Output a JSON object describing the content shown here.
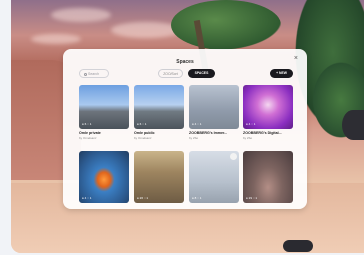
{
  "panel": {
    "title": "Spaces",
    "close_label": "×",
    "search_placeholder": "Search",
    "sort_label": "ZOO/Sort",
    "spaces_tab_label": "SPACES",
    "new_button_label": "+ NEW"
  },
  "cards": [
    {
      "title": "Ömle private",
      "owner": "by Omelsanz",
      "stats": "● 6   ◌ 1"
    },
    {
      "title": "Ömle public",
      "owner": "by Omelsanz",
      "stats": "● 6   ◌ 1"
    },
    {
      "title": "ZOOBBERG's Immer...",
      "owner": "by Zbo",
      "stats": "● 4   ◌ 1"
    },
    {
      "title": "ZOOBBERG's Digital...",
      "owner": "by Zbo",
      "stats": "● 4   ◌ 1"
    },
    {
      "title": "",
      "owner": "",
      "stats": "● 4   ◌ 1"
    },
    {
      "title": "",
      "owner": "",
      "stats": "● 26  ◌ 1"
    },
    {
      "title": "",
      "owner": "",
      "stats": "● 8   ◌ 1"
    },
    {
      "title": "",
      "owner": "",
      "stats": "● 29  ◌ 1"
    }
  ]
}
